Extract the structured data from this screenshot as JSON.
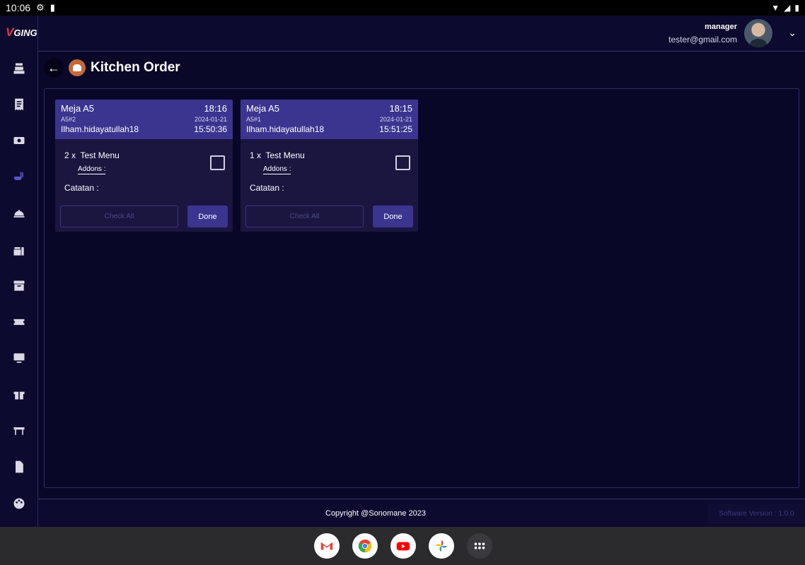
{
  "status_bar": {
    "time": "10:06"
  },
  "sidebar": {
    "logo_prefix": "V",
    "logo_text": "GING",
    "items": [
      {
        "icon": "cash-register-icon"
      },
      {
        "icon": "receipt-icon"
      },
      {
        "icon": "money-icon"
      },
      {
        "icon": "kitchen-icon",
        "active": true
      },
      {
        "icon": "food-cloche-icon"
      },
      {
        "icon": "fast-food-icon"
      },
      {
        "icon": "archive-icon"
      },
      {
        "icon": "ticket-icon"
      },
      {
        "icon": "monitor-icon"
      },
      {
        "icon": "gift-icon"
      },
      {
        "icon": "table-icon"
      },
      {
        "icon": "document-icon"
      },
      {
        "icon": "palette-icon"
      }
    ]
  },
  "header": {
    "role": "manager",
    "email": "tester@gmail.com"
  },
  "page": {
    "title": "Kitchen Order"
  },
  "orders": [
    {
      "table": "Meja A5",
      "time": "18:16",
      "code": "A5#2",
      "date": "2024-01-21",
      "user": "Ilham.hidayatullah18",
      "timestamp": "15:50:36",
      "items": [
        {
          "qty": "2 x",
          "name": "Test Menu",
          "addons_label": "Addons :"
        }
      ],
      "note_label": "Catatan :",
      "check_all_label": "Check All",
      "done_label": "Done"
    },
    {
      "table": "Meja A5",
      "time": "18:15",
      "code": "A5#1",
      "date": "2024-01-21",
      "user": "Ilham.hidayatullah18",
      "timestamp": "15:51:25",
      "items": [
        {
          "qty": "1 x",
          "name": "Test Menu",
          "addons_label": "Addons :"
        }
      ],
      "note_label": "Catatan :",
      "check_all_label": "Check All",
      "done_label": "Done"
    }
  ],
  "footer": {
    "copyright": "Copyright @Sonomane 2023",
    "version": "Software Version : 1.0.0"
  },
  "dock": [
    {
      "icon": "gmail-icon"
    },
    {
      "icon": "chrome-icon"
    },
    {
      "icon": "youtube-icon"
    },
    {
      "icon": "photos-icon"
    },
    {
      "icon": "app-drawer-icon"
    }
  ],
  "colors": {
    "background": "#0a0828",
    "card_header": "#3b3590",
    "accent_active": "#5b53c8"
  }
}
